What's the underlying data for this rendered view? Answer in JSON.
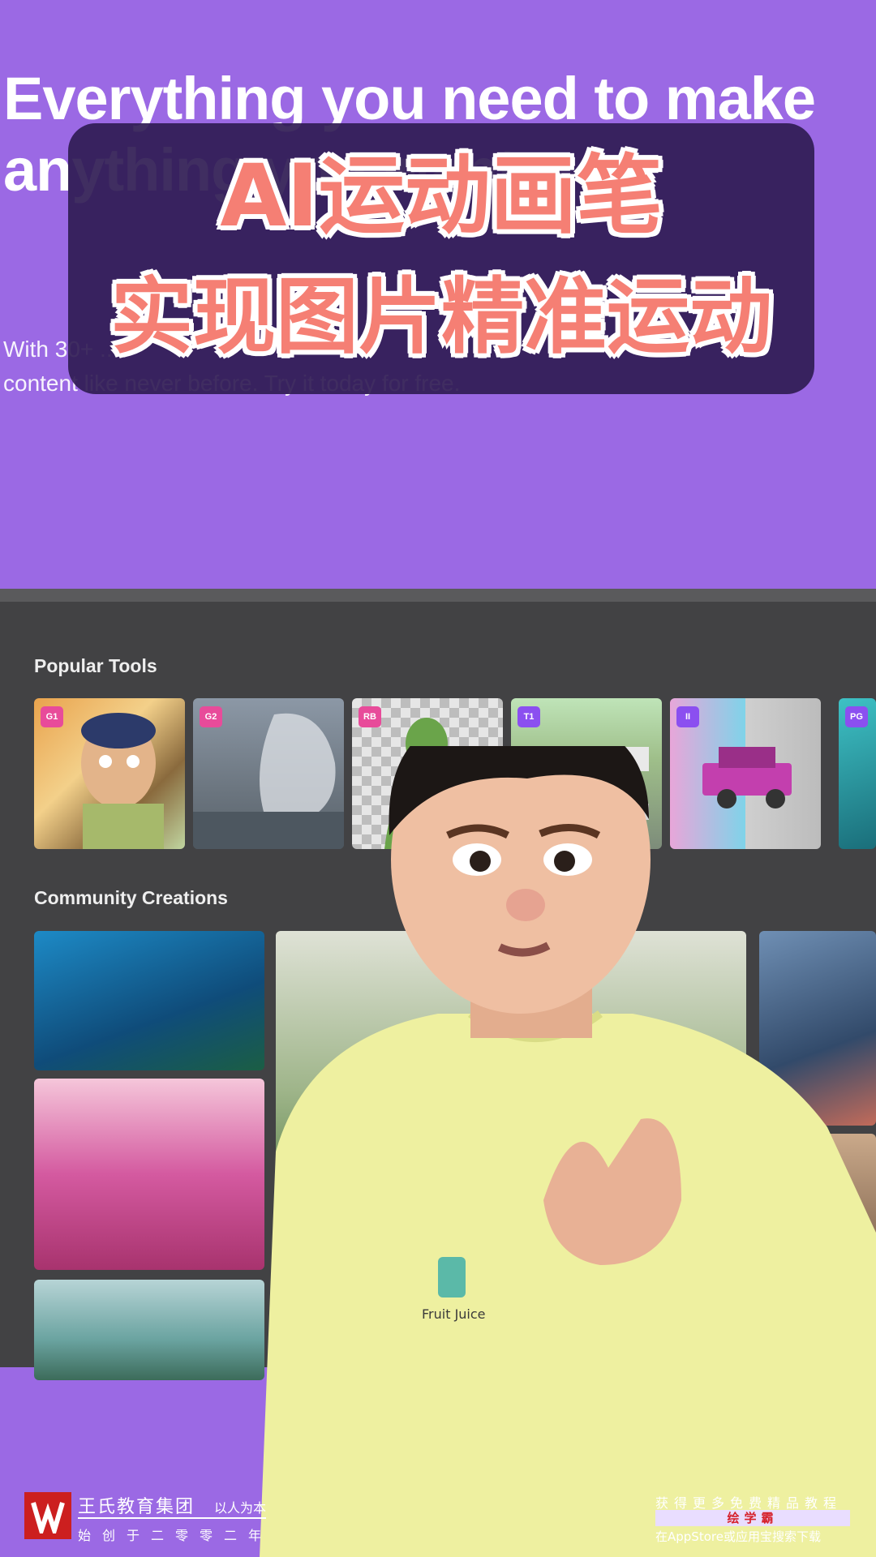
{
  "hero": {
    "title": "Everything you need to make\nanything you want",
    "subtitle": "With 30+ ...\ncontent like never before. Try it today for free."
  },
  "caption": {
    "line1": "AI运动画笔",
    "line2": "实现图片精准运动"
  },
  "panel": {
    "popular_tools_title": "Popular Tools",
    "community_title": "Community Creations",
    "tools": [
      {
        "badge": "G1",
        "badge_color": "#e84b9a"
      },
      {
        "badge": "G2",
        "badge_color": "#e84b9a"
      },
      {
        "badge": "RB",
        "badge_color": "#e84b9a"
      },
      {
        "badge": "T1",
        "badge_color": "#8b4ff0"
      },
      {
        "badge": "II",
        "badge_color": "#8b4ff0"
      },
      {
        "badge": "PG",
        "badge_color": "#8b4ff0"
      }
    ]
  },
  "presenter": {
    "shirt_logo_text": "Fruit Juice"
  },
  "footer": {
    "brand_name": "王氏教育集团",
    "motto": "以人为本",
    "since": "始创于二零零二年",
    "promo_line1": "获得更多免费精品教程",
    "promo_app": "绘学霸",
    "promo_line3": "在AppStore或应用宝搜索下载"
  }
}
